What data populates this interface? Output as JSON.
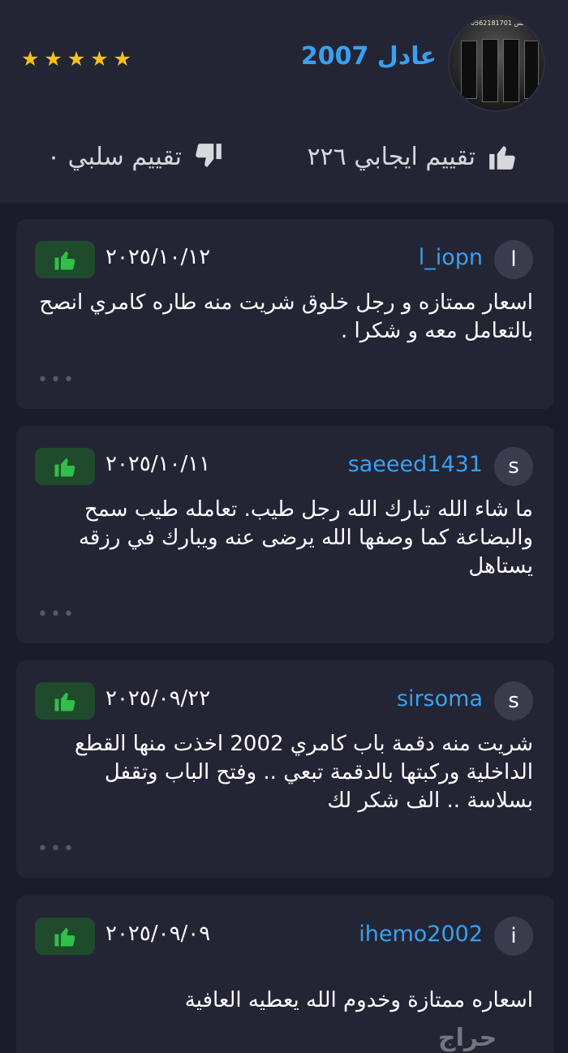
{
  "profile": {
    "username": "عادل 2007",
    "stars": "★★★★★",
    "plate_text": "واتس 0562181701",
    "positive_label": "تقييم ايجابي ٢٢٦",
    "negative_label": "تقييم سلبي ٠"
  },
  "reviews": [
    {
      "avatar_letter": "l",
      "username": "l_iopn",
      "date": "٢٠٢٥/١٠/١٢",
      "text": "اسعار ممتازه و رجل خلوق شريت منه طاره كامري انصح بالتعامل معه و شكرا .",
      "more": "•••"
    },
    {
      "avatar_letter": "s",
      "username": "saeeed1431",
      "date": "٢٠٢٥/١٠/١١",
      "text": "ما شاء الله  تبارك الله  رجل طيب. تعامله طيب سمح والبضاعة كما وصفها الله يرضى عنه ويبارك في رزقه يستاهل",
      "more": "•••"
    },
    {
      "avatar_letter": "s",
      "username": "sirsoma",
      "date": "٢٠٢٥/٠٩/٢٢",
      "text": "شريت منه دقمة باب كامري 2002 اخذت منها القطع الداخلية وركبتها بالدقمة تبعي .. وفتح الباب وتقفل بسلاسة .. الف شكر لك",
      "more": "•••"
    },
    {
      "avatar_letter": "i",
      "username": "ihemo2002",
      "date": "٢٠٢٥/٠٩/٠٩",
      "text": "اسعاره ممتازة وخدوم الله يعطيه العافية",
      "more": ""
    }
  ],
  "watermark": "حراج",
  "colors": {
    "background": "#1b1c29",
    "card": "#232535",
    "accent_blue": "#3aa0f0",
    "star": "#f6c21b",
    "thumb_green": "#2fbf4a"
  }
}
